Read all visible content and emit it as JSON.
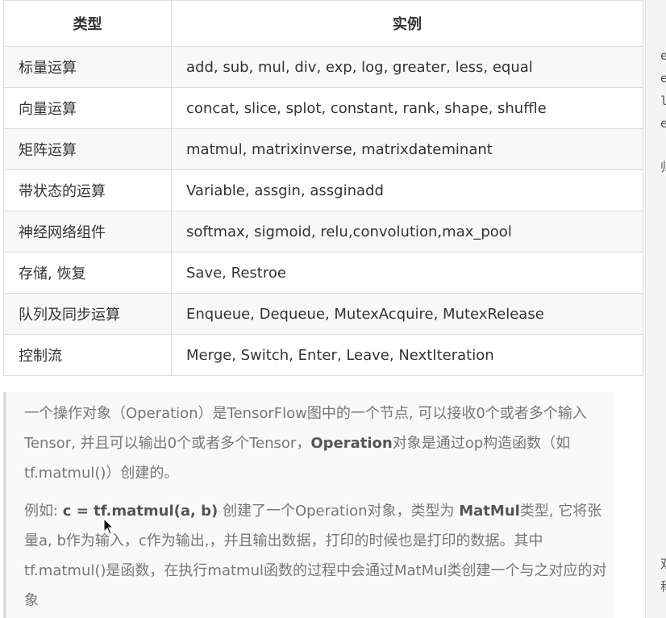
{
  "table": {
    "headers": [
      "类型",
      "实例"
    ],
    "rows": [
      {
        "type": "标量运算",
        "examples": "add, sub, mul, div, exp, log, greater, less, equal"
      },
      {
        "type": "向量运算",
        "examples": "concat, slice, splot, constant, rank, shape, shuffle"
      },
      {
        "type": "矩阵运算",
        "examples": "matmul, matrixinverse, matrixdateminant"
      },
      {
        "type": "带状态的运算",
        "examples": "Variable, assgin, assginadd"
      },
      {
        "type": "神经网络组件",
        "examples": "softmax, sigmoid, relu,convolution,max_pool"
      },
      {
        "type": "存储, 恢复",
        "examples": "Save, Restroe"
      },
      {
        "type": "队列及同步运算",
        "examples": "Enqueue, Dequeue, MutexAcquire, MutexRelease"
      },
      {
        "type": "控制流",
        "examples": "Merge, Switch, Enter, Leave, NextIteration"
      }
    ]
  },
  "quote": {
    "p1_a": "一个操作对象（Operation）是TensorFlow图中的一个节点, 可以接收0个或者多个输入Tensor, 并且可以输出0个或者多个Tensor，",
    "p1_b": "Operation",
    "p1_c": "对象是通过op构造函数（如tf.matmul()）创建的。",
    "p2_a": "例如: ",
    "p2_b": "c = tf.matmul(a, b)",
    "p2_c": " 创建了一个Operation对象，类型为 ",
    "p2_d": "MatMul",
    "p2_e": "类型, 它将张量a, b作为输入，c作为输出,，并且输出数据，打印的时候也是打印的数据。其中tf.matmul()是函数，在执行matmul函数的过程中会通过MatMul类创建一个与之对应的对象"
  },
  "sidebar_fragments": [
    "e",
    "e",
    "l",
    "er",
    "归",
    "双",
    "称"
  ],
  "colors": {
    "border": "#dddddd",
    "stripe": "#f8f8f8",
    "quote_bar": "#dddddd",
    "quote_text": "#777777"
  }
}
